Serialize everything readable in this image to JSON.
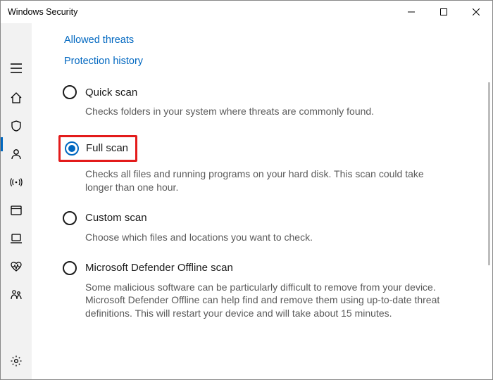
{
  "window": {
    "title": "Windows Security"
  },
  "links": {
    "allowed_threats": "Allowed threats",
    "protection_history": "Protection history"
  },
  "options": {
    "quick": {
      "title": "Quick scan",
      "desc": "Checks folders in your system where threats are commonly found."
    },
    "full": {
      "title": "Full scan",
      "desc": "Checks all files and running programs on your hard disk. This scan could take longer than one hour."
    },
    "custom": {
      "title": "Custom scan",
      "desc": "Choose which files and locations you want to check."
    },
    "offline": {
      "title": "Microsoft Defender Offline scan",
      "desc": "Some malicious software can be particularly difficult to remove from your device. Microsoft Defender Offline can help find and remove them using up-to-date threat definitions. This will restart your device and will take about 15 minutes."
    }
  },
  "selected_option": "full"
}
